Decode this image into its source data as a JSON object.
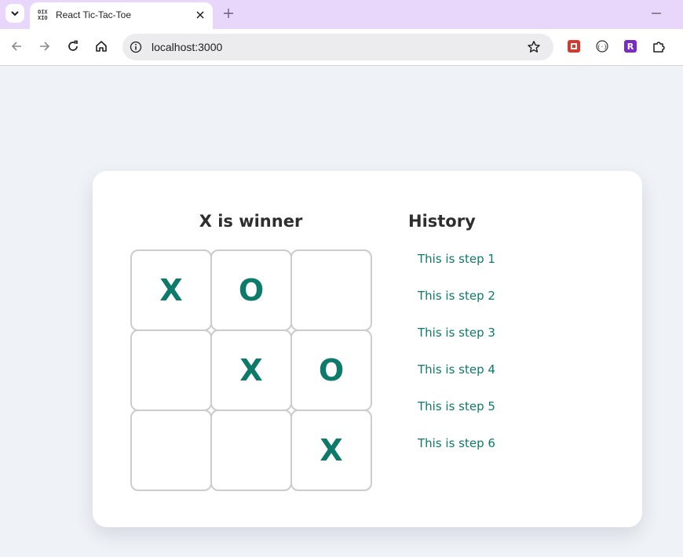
{
  "browser": {
    "tab_title": "React Tic-Tac-Toe",
    "url": "localhost:3000",
    "extension_r_label": "R",
    "icons": [
      "tab-list-icon",
      "tic-tac-toe-favicon-icon",
      "close-icon",
      "plus-icon",
      "minimize-icon",
      "back-arrow-icon",
      "forward-arrow-icon",
      "reload-icon",
      "home-icon",
      "info-icon",
      "star-icon",
      "extension-red-icon",
      "extension-bracket-icon",
      "extension-r-icon",
      "puzzle-icon"
    ]
  },
  "game": {
    "status": "X is winner",
    "board": [
      "X",
      "O",
      "",
      "",
      "X",
      "O",
      "",
      "",
      "X"
    ],
    "mark_color": "#0d7a6a"
  },
  "history": {
    "title": "History",
    "steps": [
      "This is step 1",
      "This is step 2",
      "This is step 3",
      "This is step 4",
      "This is step 5",
      "This is step 6"
    ]
  }
}
